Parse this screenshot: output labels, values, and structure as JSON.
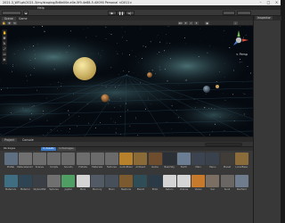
{
  "window": {
    "title": "2021.3_WFLgh/2021.3/my/staging/8d6e00e-e0e-5f9-4e88-5.4X090 Personal <DX11>"
  },
  "menu": [
    "Help"
  ],
  "scene_tabs": {
    "scene": "Scene",
    "game": "Game"
  },
  "view": {
    "persp_label": "< Persp"
  },
  "inspector": {
    "tab": "Inspector"
  },
  "project": {
    "tabs": [
      "Project",
      "Console"
    ],
    "packages_label": "Packages",
    "chip_a": "In Assets",
    "chip_b": "In Packages",
    "assets": [
      {
        "label": "Prefab",
        "color": "#5e6f82"
      },
      {
        "label": "MaterialsAnim",
        "color": "#707070"
      },
      {
        "label": "Scenes",
        "color": "#6c6c6c"
      },
      {
        "label": "Scripts",
        "color": "#6b6b6b"
      },
      {
        "label": "Sounds",
        "color": "#6a6a6a"
      },
      {
        "label": "Prefabs",
        "color": "#6d6d6d"
      },
      {
        "label": "Materials",
        "color": "#6b6b6b"
      },
      {
        "label": "Textures",
        "color": "#6a6a6a"
      },
      {
        "label": "AudioMixer",
        "color": "#b7802a"
      },
      {
        "label": "Ambient",
        "color": "#8a6a37"
      },
      {
        "label": "Game",
        "color": "#6e4d2f"
      },
      {
        "label": "BasicSky",
        "color": "#2b2f36"
      },
      {
        "label": "Earth",
        "color": "#6b7d92"
      },
      {
        "label": "Main",
        "color": "#3d4451"
      },
      {
        "label": "Menu",
        "color": "#39414c"
      },
      {
        "label": "Planet",
        "color": "#403c37"
      },
      {
        "label": "LunarBase",
        "color": "#8a6b3a"
      },
      {
        "label": "Materials",
        "color": "#3f6d82"
      },
      {
        "label": "Material",
        "color": "#2e4453"
      },
      {
        "label": "SkyboxMat",
        "color": "#3a3f46"
      },
      {
        "label": "Spheres",
        "color": "#707070"
      },
      {
        "label": "Jupiter",
        "color": "#4f9e63"
      },
      {
        "label": "Mars",
        "color": "#d4d4d4"
      },
      {
        "label": "Mercury",
        "color": "#525a66"
      },
      {
        "label": "Moon",
        "color": "#474f5a"
      },
      {
        "label": "Neptune",
        "color": "#7b5a2f"
      },
      {
        "label": "Planet",
        "color": "#2f4d57"
      },
      {
        "label": "Pluto",
        "color": "#2a3a47"
      },
      {
        "label": "Saturn",
        "color": "#d4d4d4"
      },
      {
        "label": "Uranus",
        "color": "#d4d4d4"
      },
      {
        "label": "Venus",
        "color": "#c87a2c"
      },
      {
        "label": "Sun",
        "color": "#7a6f62"
      },
      {
        "label": "Sun2",
        "color": "#6a6664"
      },
      {
        "label": "Starfield",
        "color": "#6e7c8d"
      }
    ]
  },
  "colors": {
    "accent": "#3a79c7",
    "sun": "#e8d27e",
    "grid": "#2d4a5c"
  }
}
